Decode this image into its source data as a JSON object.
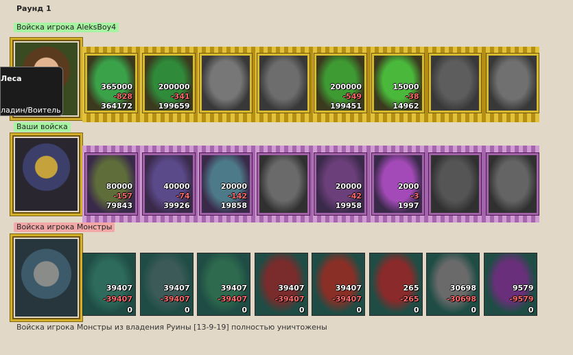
{
  "round_title": "Раунд 1",
  "groups": [
    {
      "label": "Войска игрока AleksBoy4",
      "label_color": "#9cf39a",
      "theme": "gold",
      "tooltip": {
        "line1": "Леса",
        "line2": "ладин/Воитель"
      },
      "units": [
        {
          "n1": "365000",
          "n2": "-828",
          "n3": "364172",
          "state": "alive",
          "color": "#3aa34a"
        },
        {
          "n1": "200000",
          "n2": "-341",
          "n3": "199659",
          "state": "alive",
          "color": "#2f8a3a"
        },
        {
          "n1": "",
          "n2": "",
          "n3": "",
          "state": "dead",
          "color": "#777777"
        },
        {
          "n1": "",
          "n2": "",
          "n3": "",
          "state": "dead",
          "color": "#6d6d6d"
        },
        {
          "n1": "200000",
          "n2": "-549",
          "n3": "199451",
          "state": "alive",
          "color": "#3e9b33"
        },
        {
          "n1": "15000",
          "n2": "-38",
          "n3": "14962",
          "state": "alive",
          "color": "#4ab83b"
        },
        {
          "n1": "",
          "n2": "",
          "n3": "",
          "state": "dead",
          "color": "#5d5d5d"
        },
        {
          "n1": "",
          "n2": "",
          "n3": "",
          "state": "dead",
          "color": "#707070"
        }
      ]
    },
    {
      "label": "Ваши войска",
      "label_color": "#9cf39a",
      "theme": "purple",
      "units": [
        {
          "n1": "80000",
          "n2": "-157",
          "n3": "79843",
          "state": "alive",
          "color": "#5e6d3a"
        },
        {
          "n1": "40000",
          "n2": "-74",
          "n3": "39926",
          "state": "alive",
          "color": "#5b4a8a"
        },
        {
          "n1": "20000",
          "n2": "-142",
          "n3": "19858",
          "state": "alive",
          "color": "#4d7a88"
        },
        {
          "n1": "",
          "n2": "",
          "n3": "",
          "state": "dead",
          "color": "#6a6a6a"
        },
        {
          "n1": "20000",
          "n2": "-42",
          "n3": "19958",
          "state": "alive",
          "color": "#6b3f7a"
        },
        {
          "n1": "2000",
          "n2": "-3",
          "n3": "1997",
          "state": "alive",
          "color": "#a44ab8"
        },
        {
          "n1": "",
          "n2": "",
          "n3": "",
          "state": "dead",
          "color": "#555555"
        },
        {
          "n1": "",
          "n2": "",
          "n3": "",
          "state": "dead",
          "color": "#646464"
        }
      ]
    },
    {
      "label": "Войска игрока Монстры",
      "label_color": "#f2a4a4",
      "theme": "plain",
      "units": [
        {
          "n1": "39407",
          "n2": "-39407",
          "n3": "0",
          "state": "alive",
          "color": "#2e6b5c"
        },
        {
          "n1": "39407",
          "n2": "-39407",
          "n3": "0",
          "state": "alive",
          "color": "#3b5a58"
        },
        {
          "n1": "39407",
          "n2": "-39407",
          "n3": "0",
          "state": "alive",
          "color": "#2e6a4d"
        },
        {
          "n1": "39407",
          "n2": "-39407",
          "n3": "0",
          "state": "alive",
          "color": "#7a2b2b"
        },
        {
          "n1": "39407",
          "n2": "-39407",
          "n3": "0",
          "state": "alive",
          "color": "#8a2f26"
        },
        {
          "n1": "265",
          "n2": "-265",
          "n3": "0",
          "state": "alive",
          "color": "#8a2a2a"
        },
        {
          "n1": "30698",
          "n2": "-30698",
          "n3": "0",
          "state": "alive",
          "color": "#6a6a6a"
        },
        {
          "n1": "9579",
          "n2": "-9579",
          "n3": "0",
          "state": "alive",
          "color": "#6a2f7a"
        }
      ]
    }
  ],
  "footer": "Войска игрока Монстры из владения Руины [13-9-19] полностью уничтожены"
}
